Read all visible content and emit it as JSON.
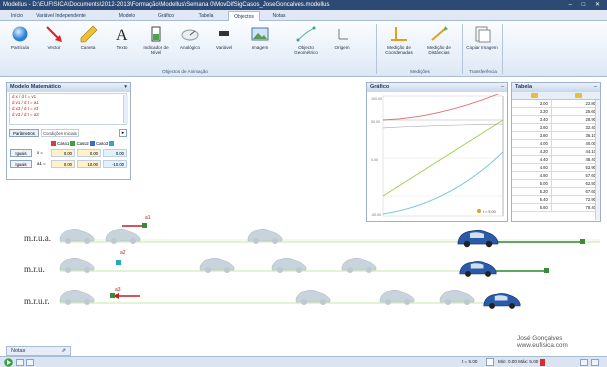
{
  "window": {
    "title": "Modellus - D:\\EUFISICA\\Documents\\2012-2013\\Formação\\Modellus\\Semana 0\\MovDifSigCasos_JoseGoncalves.modellus",
    "controls": "–  □  ✕"
  },
  "tabs": [
    "Início",
    "Variável Independente",
    "Modelo",
    "Gráfico",
    "Tabela",
    "Objectos",
    "Notas"
  ],
  "active_tab": "Objectos",
  "ribbon": {
    "buttons": [
      {
        "label": "Partícula",
        "icon": "particle-icon"
      },
      {
        "label": "Vector",
        "icon": "vector-icon"
      },
      {
        "label": "Caneta",
        "icon": "pen-icon"
      },
      {
        "label": "Texto",
        "icon": "text-icon"
      },
      {
        "label": "Indicador de Nível",
        "icon": "level-indicator-icon"
      },
      {
        "label": "Analógico",
        "icon": "analog-icon"
      },
      {
        "label": "Variável",
        "icon": "variable-icon"
      },
      {
        "label": "Imagem",
        "icon": "image-icon"
      },
      {
        "label": "Objecto Geométrico",
        "icon": "geometric-object-icon"
      },
      {
        "label": "Origem",
        "icon": "origin-icon"
      },
      {
        "label": "Medição de Coordenadas",
        "icon": "coordinate-measure-icon"
      },
      {
        "label": "Medição de Distâncias",
        "icon": "distance-measure-icon"
      },
      {
        "label": "Copiar Imagem",
        "icon": "copy-image-icon"
      }
    ],
    "groups": [
      "Objectos de Animação",
      "Medições",
      "Transferência"
    ]
  },
  "model_panel": {
    "title": "Modelo Matemático",
    "equations": [
      "d x / d t = v1",
      "d v1 / d t = a1",
      "d x3 / d t = v3",
      "d v3 / d t = a3"
    ],
    "buttons": [
      "Parâmetros",
      "Condições Iniciais"
    ],
    "case_headers": [
      "Caso1",
      "Caso2",
      "Caso3",
      "Caso"
    ],
    "case_colors": [
      "#d04040",
      "#40a040",
      "#3c6cc8",
      "#2fa9c0"
    ],
    "rows": [
      {
        "button": "Iguais",
        "var": "x =",
        "values": [
          "0.00",
          "0.00",
          "0.00"
        ]
      },
      {
        "button": "Iguais",
        "var": "a1 =",
        "values": [
          "0.00",
          "10.00",
          "-10.00"
        ]
      }
    ]
  },
  "graph_panel": {
    "title": "Gráfico",
    "y_ticks": [
      "100.00",
      "50.00",
      "0.00",
      "-50.00"
    ],
    "legend": "t = 5.00",
    "series_colors": [
      "#e07070",
      "#9bcf4e",
      "#75c8e0",
      "#a0a0a0"
    ]
  },
  "table_panel": {
    "title": "Tabela",
    "rows": [
      [
        "3.00",
        "22.80"
      ],
      [
        "3.20",
        "25.60"
      ],
      [
        "3.40",
        "28.90"
      ],
      [
        "3.60",
        "32.40"
      ],
      [
        "3.80",
        "36.10"
      ],
      [
        "4.00",
        "40.00"
      ],
      [
        "4.20",
        "44.10"
      ],
      [
        "4.40",
        "48.40"
      ],
      [
        "4.60",
        "52.90"
      ],
      [
        "4.80",
        "57.60"
      ],
      [
        "5.00",
        "62.50"
      ],
      [
        "5.20",
        "67.60"
      ],
      [
        "5.40",
        "72.90"
      ],
      [
        "5.60",
        "78.40"
      ]
    ]
  },
  "canvas": {
    "labels": [
      "m.r.u.a.",
      "m.r.u.",
      "m.r.u.r."
    ],
    "vector_labels": [
      "a1",
      "a2",
      "a3"
    ],
    "credit_name": "José Gonçalves",
    "credit_url": "www.eufisica.com"
  },
  "notes": {
    "label": "Notas"
  },
  "status": {
    "time_label": "t = 5.00",
    "range": "Min: 0.00  Máx: 5.00"
  }
}
